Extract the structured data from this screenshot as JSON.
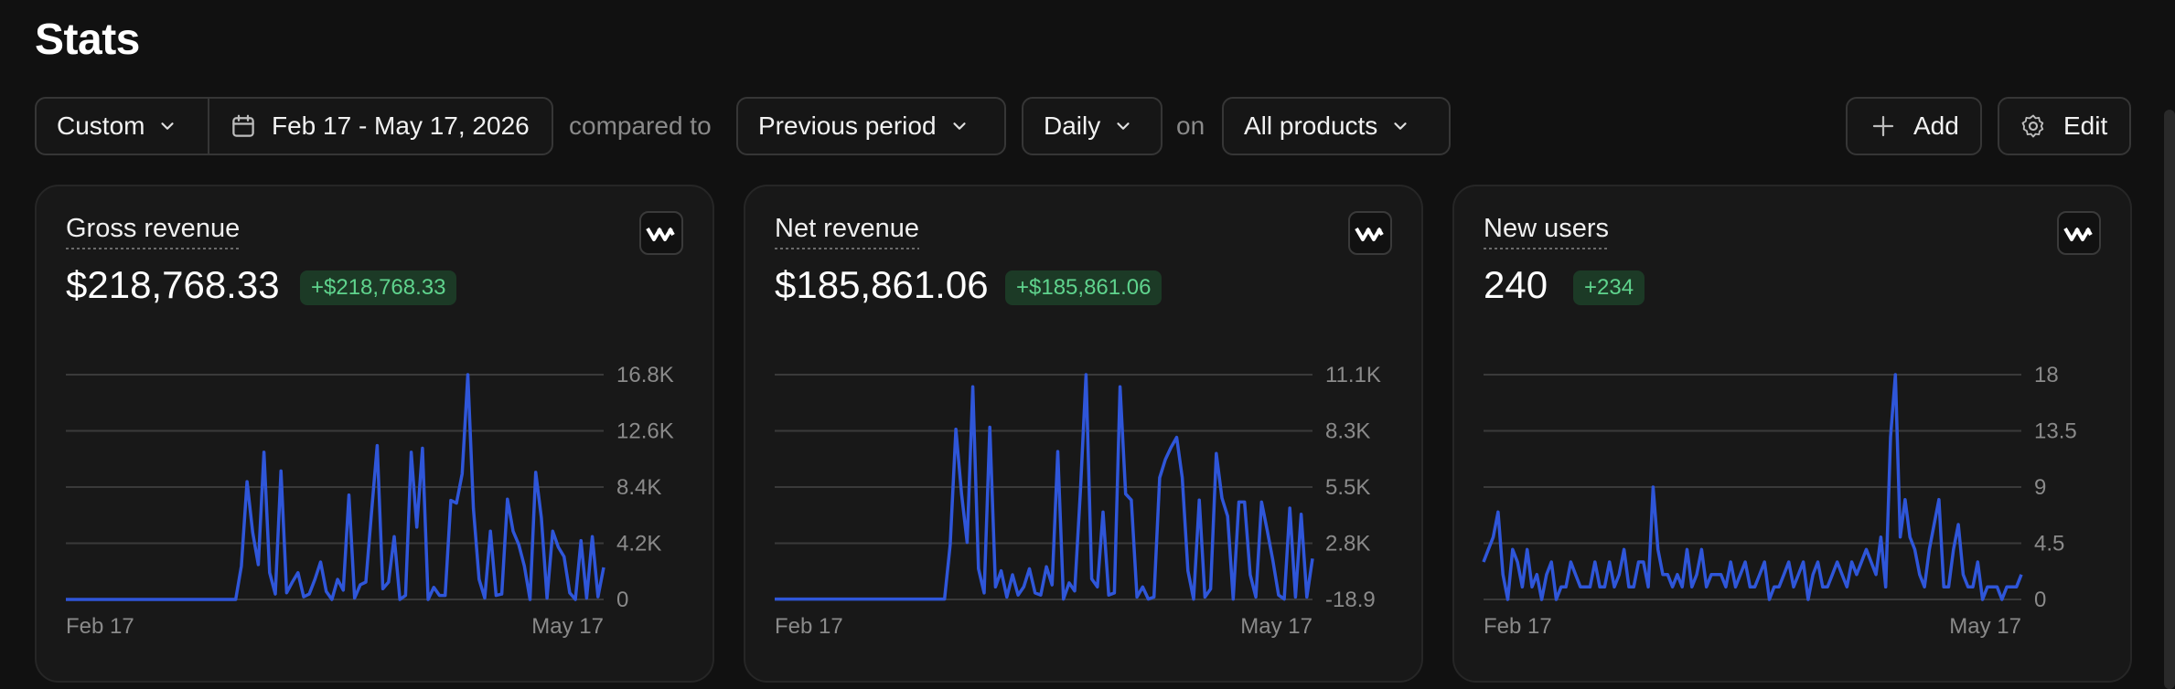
{
  "page": {
    "title": "Stats"
  },
  "toolbar": {
    "range_preset": "Custom",
    "date_range": "Feb 17 - May 17, 2026",
    "compared_to_text": "compared to",
    "comparison": "Previous period",
    "interval": "Daily",
    "on_text": "on",
    "products": "All products",
    "add_label": "Add",
    "edit_label": "Edit"
  },
  "cards": [
    {
      "label": "Gross revenue",
      "value": "$218,768.33",
      "change": "+$218,768.33"
    },
    {
      "label": "Net revenue",
      "value": "$185,861.06",
      "change": "+$185,861.06"
    },
    {
      "label": "New users",
      "value": "240",
      "change": "+234"
    }
  ],
  "colors": {
    "line": "#2f56d9",
    "badge_bg": "#1c3a26",
    "badge_text": "#5fd38d",
    "grid": "#3a3a3a"
  },
  "chart_data": [
    {
      "type": "line",
      "title": "Gross revenue",
      "x_start_label": "Feb 17",
      "x_end_label": "May 17",
      "y_ticks": [
        "16.8K",
        "12.6K",
        "8.4K",
        "4.2K",
        "0"
      ],
      "ylim": [
        0,
        16800
      ],
      "series": [
        {
          "values": [
            0,
            0,
            0,
            0,
            0,
            0,
            0,
            0,
            0,
            0,
            0,
            0,
            0,
            0,
            0,
            0,
            0,
            0,
            0,
            0,
            0,
            0,
            0,
            0,
            0,
            0,
            0,
            0,
            0,
            0,
            0,
            2500,
            8800,
            5000,
            2600,
            11000,
            2000,
            400,
            9600,
            500,
            1300,
            2000,
            200,
            400,
            1500,
            2800,
            600,
            0,
            1500,
            700,
            7800,
            100,
            1100,
            1300,
            6500,
            11500,
            800,
            1300,
            4700,
            0,
            300,
            11000,
            5400,
            11300,
            0,
            900,
            300,
            300,
            7400,
            7200,
            9400,
            16800,
            6800,
            1500,
            100,
            5100,
            300,
            400,
            7500,
            5100,
            4100,
            2500,
            0,
            9500,
            6100,
            100,
            5100,
            3900,
            3200,
            500,
            0,
            4400,
            100,
            4700,
            200,
            2400
          ]
        }
      ]
    },
    {
      "type": "line",
      "title": "Net revenue",
      "x_start_label": "Feb 17",
      "x_end_label": "May 17",
      "y_ticks": [
        "11.1K",
        "8.3K",
        "5.5K",
        "2.8K",
        "-18.9"
      ],
      "ylim": [
        -18.9,
        11100
      ],
      "series": [
        {
          "values": [
            0,
            0,
            0,
            0,
            0,
            0,
            0,
            0,
            0,
            0,
            0,
            0,
            0,
            0,
            0,
            0,
            0,
            0,
            0,
            0,
            0,
            0,
            0,
            0,
            0,
            0,
            0,
            0,
            0,
            0,
            0,
            2700,
            8400,
            5200,
            2800,
            10500,
            1500,
            300,
            8500,
            600,
            1400,
            100,
            1200,
            200,
            600,
            1500,
            300,
            200,
            1600,
            700,
            7300,
            0,
            800,
            400,
            5300,
            11100,
            1000,
            600,
            4300,
            200,
            300,
            10500,
            5200,
            4900,
            100,
            600,
            0,
            100,
            6000,
            6900,
            7500,
            8000,
            6000,
            1400,
            0,
            4900,
            100,
            500,
            7200,
            5000,
            4100,
            0,
            4800,
            4800,
            1200,
            100,
            4800,
            3400,
            1900,
            200,
            0,
            4500,
            100,
            4200,
            100,
            2000
          ]
        }
      ]
    },
    {
      "type": "line",
      "title": "New users",
      "x_start_label": "Feb 17",
      "x_end_label": "May 17",
      "y_ticks": [
        "18",
        "13.5",
        "9",
        "4.5",
        "0"
      ],
      "ylim": [
        0,
        18
      ],
      "series": [
        {
          "values": [
            3,
            4,
            5,
            7,
            2,
            0,
            4,
            3,
            1,
            4,
            1,
            2,
            0,
            2,
            3,
            0,
            1,
            1,
            3,
            2,
            1,
            1,
            1,
            3,
            1,
            1,
            3,
            1,
            2,
            4,
            1,
            1,
            3,
            3,
            1,
            9,
            4,
            2,
            2,
            1,
            2,
            1,
            4,
            1,
            2,
            4,
            1,
            2,
            2,
            2,
            1,
            3,
            1,
            2,
            3,
            1,
            1,
            2,
            3,
            0,
            1,
            1,
            2,
            3,
            1,
            2,
            3,
            0,
            2,
            3,
            1,
            1,
            2,
            3,
            2,
            1,
            3,
            2,
            3,
            4,
            3,
            2,
            5,
            1,
            13,
            18,
            5,
            8,
            5,
            4,
            2,
            1,
            4,
            6,
            8,
            1,
            1,
            4,
            6,
            2,
            1,
            1,
            3,
            0,
            1,
            1,
            1,
            0,
            1,
            1,
            1,
            2
          ]
        }
      ]
    }
  ]
}
